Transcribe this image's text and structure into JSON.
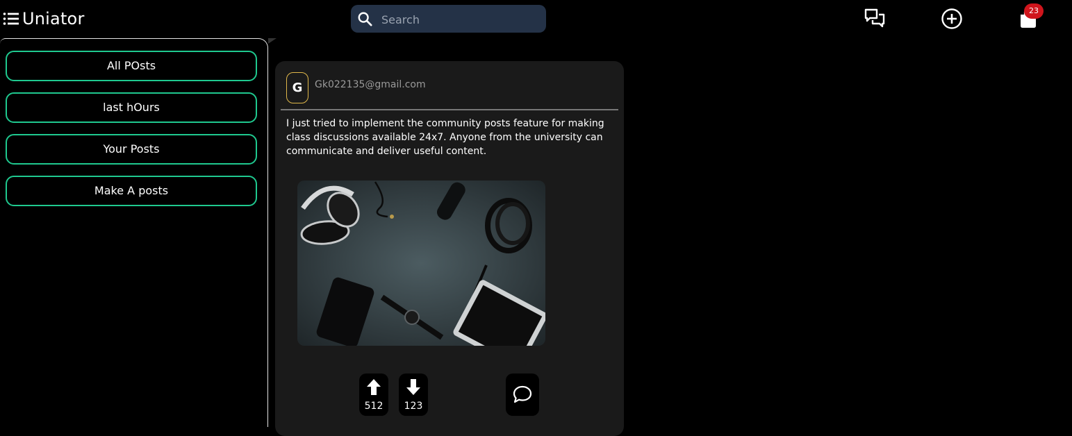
{
  "app": {
    "title": "Uniator"
  },
  "search": {
    "placeholder": "Search"
  },
  "nav": {
    "icons": [
      "chat-bubbles-icon",
      "add-circle-icon",
      "notification-bag-icon"
    ],
    "badge_count": "23"
  },
  "sidebar": {
    "items": [
      {
        "label": "All POsts"
      },
      {
        "label": "last hOurs"
      },
      {
        "label": "Your Posts"
      },
      {
        "label": "Make A posts"
      }
    ]
  },
  "post": {
    "avatar_letter": "G",
    "author": "Gk022135@gmail.com",
    "text": "I just tried to implement the community posts feature for making class discussions available 24x7. Anyone from the university can communicate and deliver useful content.",
    "image_alt": "Flat lay of headphones, watch, tablet, wallet, pen and belt on dark surface",
    "upvotes": "512",
    "downvotes": "123"
  },
  "colors": {
    "accent": "#1fc98f",
    "search_bg": "#243247",
    "card_bg": "#1a1a1a",
    "badge": "#d0151c",
    "avatar_border": "#e0b84a"
  }
}
